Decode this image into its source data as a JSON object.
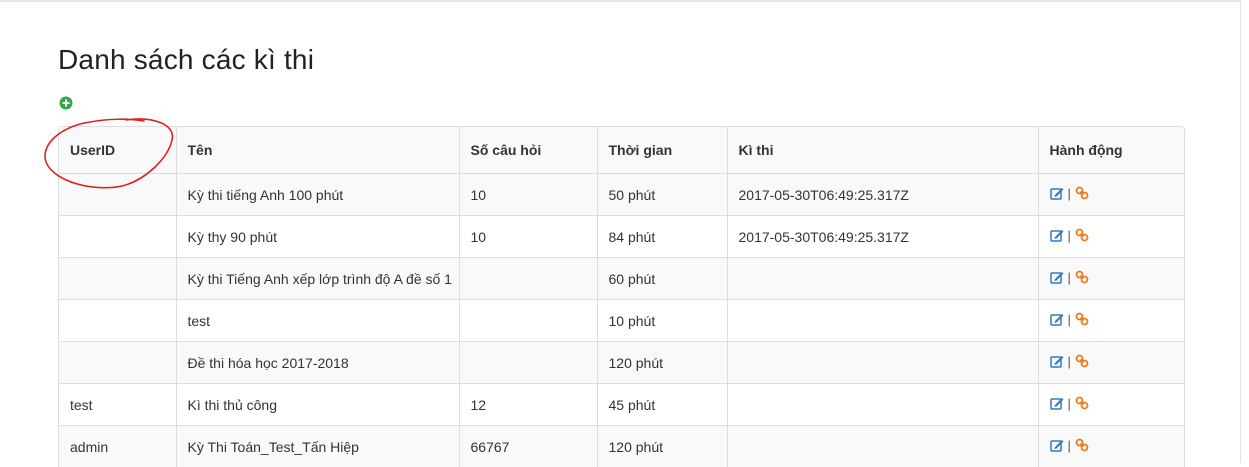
{
  "page": {
    "title": "Danh sách các kì thi"
  },
  "toolbar": {
    "add_icon": "plus-circle-icon",
    "add_color": "#2eaa47"
  },
  "table": {
    "headers": [
      "UserID",
      "Tên",
      "Số câu hỏi",
      "Thời gian",
      "Kì thi",
      "Hành động"
    ],
    "rows": [
      {
        "userid": "",
        "name": "Kỳ thi tiếng Anh 100 phút",
        "questions": "10",
        "time": "50 phút",
        "exam": "2017-05-30T06:49:25.317Z"
      },
      {
        "userid": "",
        "name": "Kỳ thy 90 phút",
        "questions": "10",
        "time": "84 phút",
        "exam": "2017-05-30T06:49:25.317Z"
      },
      {
        "userid": "",
        "name": "Kỳ thi Tiếng Anh xếp lớp trình độ A đề số 1",
        "questions": "",
        "time": "60 phút",
        "exam": ""
      },
      {
        "userid": "",
        "name": "test",
        "questions": "",
        "time": "10 phút",
        "exam": ""
      },
      {
        "userid": "",
        "name": "Đề thi hóa học 2017-2018",
        "questions": "",
        "time": "120 phút",
        "exam": ""
      },
      {
        "userid": "test",
        "name": "Kì thi thủ công",
        "questions": "12",
        "time": "45 phút",
        "exam": ""
      },
      {
        "userid": "admin",
        "name": "Kỳ Thi Toán_Test_Tấn Hiệp",
        "questions": "66767",
        "time": "120 phút",
        "exam": ""
      }
    ],
    "action_separator": "|",
    "edit_icon": "edit-icon",
    "link_icon": "link-icon",
    "edit_color": "#337ab7",
    "link_color": "#e67e22"
  },
  "annotation": {
    "color": "#e02020",
    "shape": "hand-drawn-circle"
  }
}
